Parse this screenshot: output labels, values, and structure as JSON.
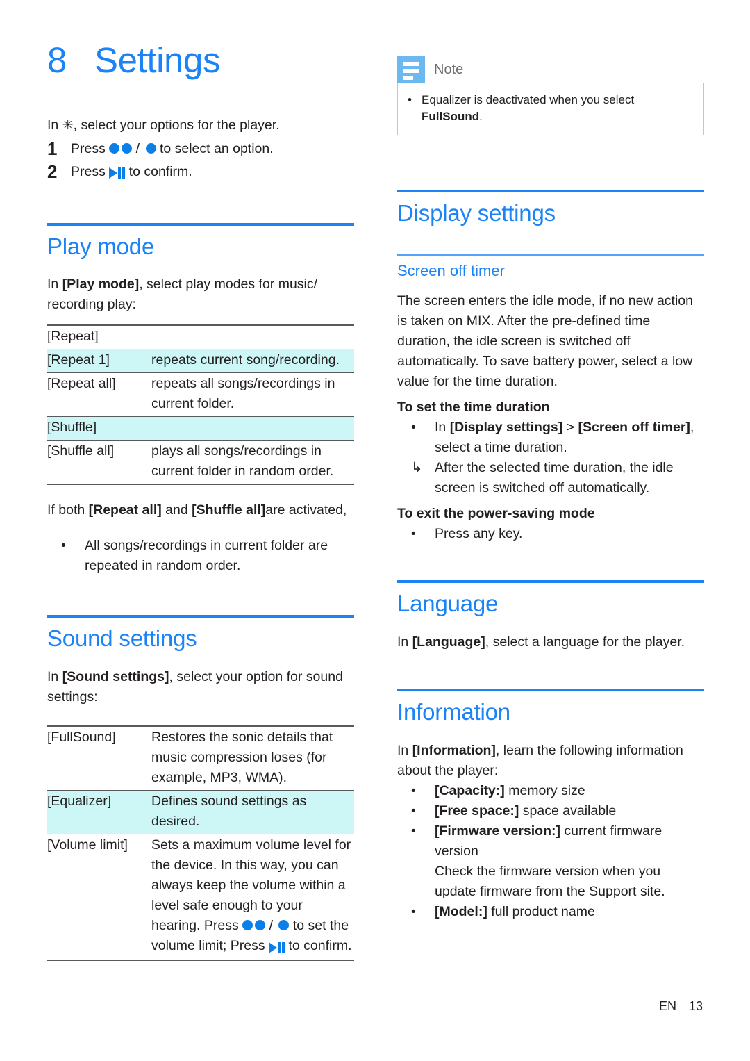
{
  "chapter": {
    "number": "8",
    "title": "Settings"
  },
  "intro": {
    "lead_before": "In ",
    "gear_icon": "gear-icon",
    "lead_after": ", select your options for the player.",
    "steps": [
      {
        "n": "1",
        "before": "Press ",
        "glyphs": "up-dot down-dot / ok-dot",
        "after": " to select an option."
      },
      {
        "n": "2",
        "before": "Press ",
        "glyphs": "play-pause",
        "after": " to confirm."
      }
    ]
  },
  "play_mode": {
    "title": "Play mode",
    "intro_before": "In ",
    "intro_bold": "[Play mode]",
    "intro_after": ", select play modes for music/ recording play:",
    "table": [
      {
        "key": "[Repeat]",
        "value": "",
        "highlight": false
      },
      {
        "key": "[Repeat 1]",
        "value": "repeats current song/recording.",
        "highlight": true
      },
      {
        "key": "[Repeat all]",
        "value": "repeats all songs/recordings in current folder.",
        "highlight": false
      },
      {
        "key": "[Shuffle]",
        "value": "",
        "highlight": true
      },
      {
        "key": "[Shuffle all]",
        "value": "plays all songs/recordings in current folder in random order.",
        "highlight": false
      }
    ],
    "after_before": "If both ",
    "after_bold1": "[Repeat all]",
    "after_mid": " and ",
    "after_bold2": "[Shuffle all]",
    "after_end": "are activated,",
    "after_bullet": "All songs/recordings in current folder are repeated in random order."
  },
  "sound_settings": {
    "title": "Sound settings",
    "intro_before": " In ",
    "intro_bold": "[Sound settings]",
    "intro_after": ", select your option for sound settings:",
    "table": [
      {
        "key": "[FullSound]",
        "value": "Restores the sonic details that music compression loses (for example, MP3, WMA).",
        "highlight": false
      },
      {
        "key": "[Equalizer]",
        "value": "Defines sound settings as desired.",
        "highlight": true
      },
      {
        "key": "[Volume limit]",
        "value_p1": "Sets a maximum volume level for the device. In this way, you can always keep the volume within a level safe enough to your hearing. Press ",
        "value_p2": " to set the volume limit; Press ",
        "value_p3": " to confirm.",
        "highlight": false
      }
    ]
  },
  "note": {
    "icon": "note-icon",
    "title": "Note",
    "bullet_before": "Equalizer is deactivated when you select ",
    "bullet_bold": "FullSound",
    "bullet_after": "."
  },
  "display_settings": {
    "title": "Display settings",
    "sub_title": "Screen off timer",
    "paragraph": "The screen enters the idle mode, if no new action is taken on MIX. After the pre-defined time duration, the idle screen is switched off automatically. To save battery power, select a low value for the time duration.",
    "set_heading": "To set the time duration",
    "set_bullet_before": "In ",
    "set_bullet_b1": "[Display settings]",
    "set_bullet_mid": " > ",
    "set_bullet_b2": "[Screen off timer]",
    "set_bullet_after": ", select a time duration.",
    "set_subbullet": "After the selected time duration, the idle screen is switched off automatically.",
    "exit_heading": "To exit the power-saving mode",
    "exit_bullet": "Press any key."
  },
  "language": {
    "title": "Language",
    "intro_before": "In ",
    "intro_bold": "[Language]",
    "intro_after": ", select a language for the player."
  },
  "information": {
    "title": "Information",
    "intro_before": "In ",
    "intro_bold": "[Information]",
    "intro_after": ", learn the following information about the player:",
    "items": [
      {
        "bold": "[Capacity:]",
        "rest": " memory size"
      },
      {
        "bold": "[Free space:]",
        "rest": " space available"
      },
      {
        "bold": "[Firmware version:]",
        "rest": " current firmware version"
      },
      {
        "bold": "[Model:]",
        "rest": " full product name"
      }
    ],
    "firmware_note": "Check the firmware version when you update firmware from the Support site."
  },
  "footer": {
    "language_code": "EN",
    "page_number": "13"
  },
  "colors": {
    "accent_blue": "#1b83f5",
    "glyph_blue": "#0b7fe8",
    "highlight_cyan": "#cdf6f6",
    "note_icon_blue": "#6cb8f0",
    "rule_gray": "#58595b"
  }
}
